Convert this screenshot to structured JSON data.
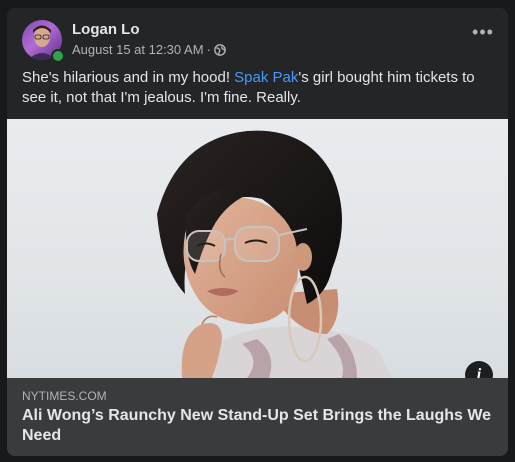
{
  "post": {
    "author": "Logan Lo",
    "timestamp": "August 15 at 12:30 AM",
    "separator": "·",
    "privacy_icon": "globe-icon",
    "more_label": "•••",
    "text_before": "She's hilarious and in my hood! ",
    "mention": "Spak Pak",
    "text_after": "'s girl bought him tickets to see it, not that I'm jealous. I'm fine. Really."
  },
  "link_preview": {
    "domain": "NYTIMES.COM",
    "title": "Ali Wong’s Raunchy New Stand-Up Set Brings the Laughs We Need",
    "info_label": "i"
  },
  "colors": {
    "card_bg": "#242526",
    "link_box_bg": "#3a3b3c",
    "mention": "#4599ff",
    "online": "#31a24c"
  }
}
